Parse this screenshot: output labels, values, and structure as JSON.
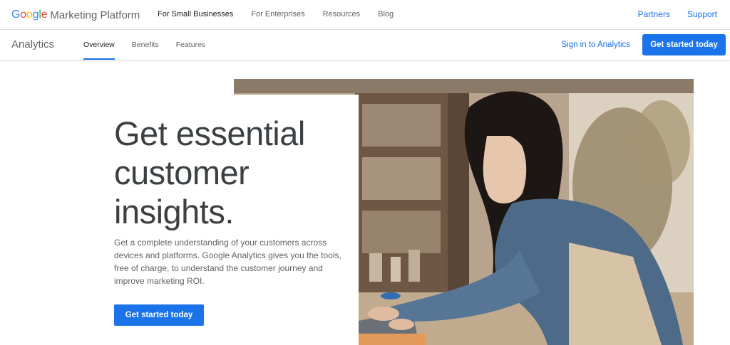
{
  "brand": {
    "google_letters": [
      "G",
      "o",
      "o",
      "g",
      "l",
      "e"
    ],
    "name": "Marketing Platform"
  },
  "top_nav": {
    "items": [
      "For Small Businesses",
      "For Enterprises",
      "Resources",
      "Blog"
    ],
    "active": "For Small Businesses"
  },
  "top_right": {
    "partners": "Partners",
    "support": "Support"
  },
  "sub_bar": {
    "product": "Analytics",
    "tabs": [
      "Overview",
      "Benefits",
      "Features"
    ],
    "active_tab": "Overview",
    "sign_in": "Sign in to Analytics",
    "cta": "Get started today"
  },
  "hero": {
    "headline": "Get essential customer insights.",
    "description": "Get a complete understanding of your customers across devices and platforms. Google Analytics gives you the tools, free of charge, to understand the customer journey and improve marketing ROI.",
    "cta": "Get started today"
  },
  "colors": {
    "accent": "#1a73e8",
    "google_blue": "#4285f4",
    "google_red": "#ea4335",
    "google_yellow": "#fbbc05",
    "google_green": "#34a853"
  }
}
